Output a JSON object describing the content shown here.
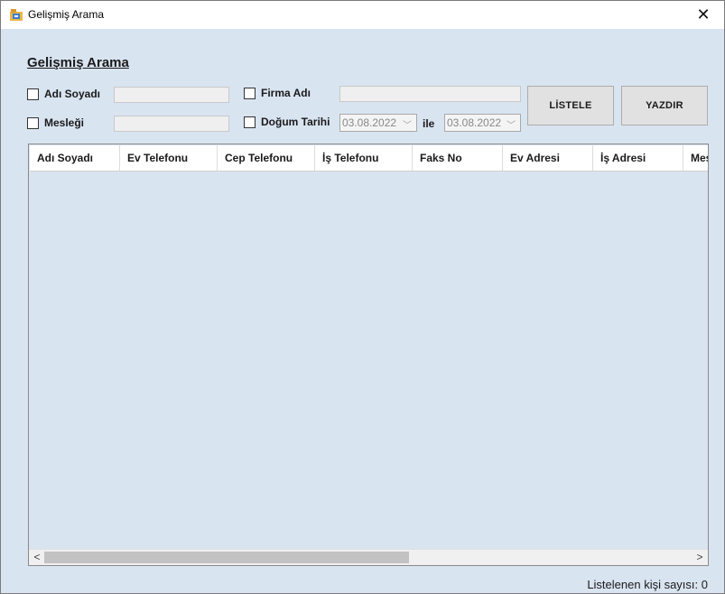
{
  "window": {
    "title": "Gelişmiş Arama",
    "close_label": "✕"
  },
  "form": {
    "heading": "Gelişmiş Arama",
    "adi_soyadi_label": "Adı Soyadı",
    "adi_soyadi_checked": false,
    "adi_soyadi_value": "",
    "meslegi_label": "Mesleği",
    "meslegi_checked": false,
    "meslegi_value": "",
    "firma_adi_label": "Firma Adı",
    "firma_adi_checked": false,
    "firma_adi_value": "",
    "dogum_tarihi_label": "Doğum Tarihi",
    "dogum_tarihi_checked": false,
    "date_from": "03.08.2022",
    "date_to": "03.08.2022",
    "ile_label": "ile"
  },
  "buttons": {
    "listele": "LİSTELE",
    "yazdir": "YAZDIR"
  },
  "grid": {
    "columns": [
      "Adı Soyadı",
      "Ev Telefonu",
      "Cep Telefonu",
      "İş Telefonu",
      "Faks No",
      "Ev Adresi",
      "İş Adresi",
      "Mesleği"
    ],
    "rows": []
  },
  "status": {
    "text": "Listelenen kişi sayısı: 0"
  }
}
